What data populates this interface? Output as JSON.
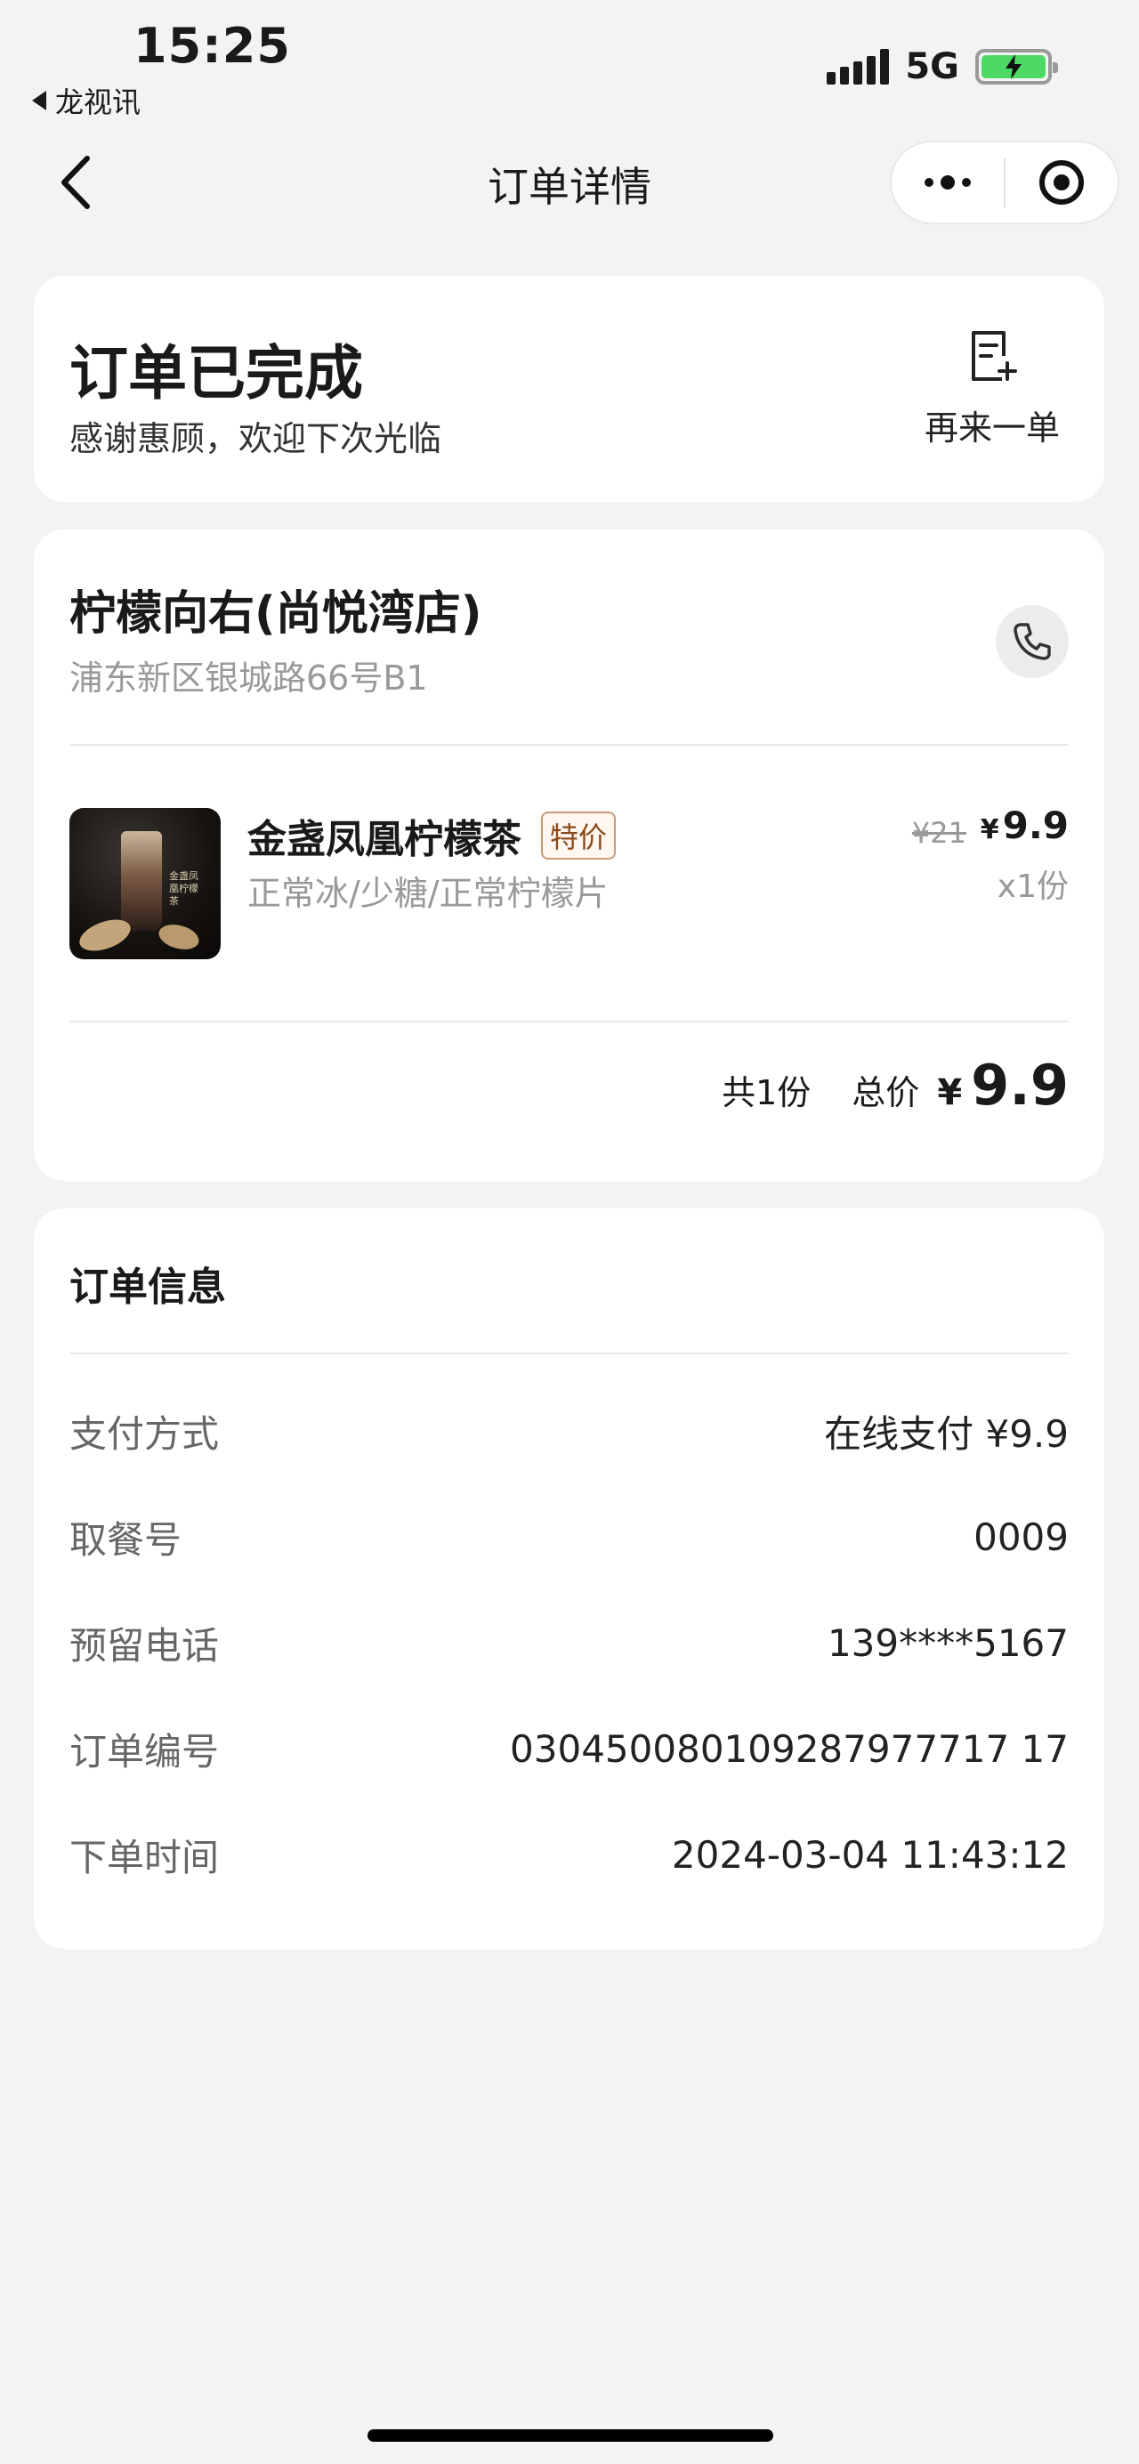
{
  "status_bar": {
    "time": "15:25",
    "back_app": "龙视讯",
    "network": "5G"
  },
  "nav": {
    "title": "订单详情"
  },
  "order_status": {
    "title": "订单已完成",
    "subtitle": "感谢惠顾，欢迎下次光临",
    "reorder_label": "再来一单"
  },
  "store": {
    "name": "柠檬向右(尚悦湾店)",
    "address": "浦东新区银城路66号B1"
  },
  "product": {
    "name": "金盏凤凰柠檬茶",
    "tag": "特价",
    "options": "正常冰/少糖/正常柠檬片",
    "original_price": "¥21",
    "currency": "¥",
    "price": "9.9",
    "quantity": "x1份",
    "image_text": "金盏凤凰柠檬茶"
  },
  "summary": {
    "count": "共1份",
    "total_label": "总价",
    "currency": "¥",
    "total": "9.9"
  },
  "order_info": {
    "title": "订单信息",
    "rows": [
      {
        "key": "支付方式",
        "value": "在线支付 ¥9.9"
      },
      {
        "key": "取餐号",
        "value": "0009"
      },
      {
        "key": "预留电话",
        "value": "139****5167"
      },
      {
        "key": "订单编号",
        "value": "030450080109287977717 17"
      },
      {
        "key": "下单时间",
        "value": "2024-03-04 11:43:12"
      }
    ]
  },
  "colors": {
    "background": "#f3f3f3",
    "card": "#ffffff",
    "tag_text": "#8a4b1c",
    "battery": "#4cd964"
  }
}
